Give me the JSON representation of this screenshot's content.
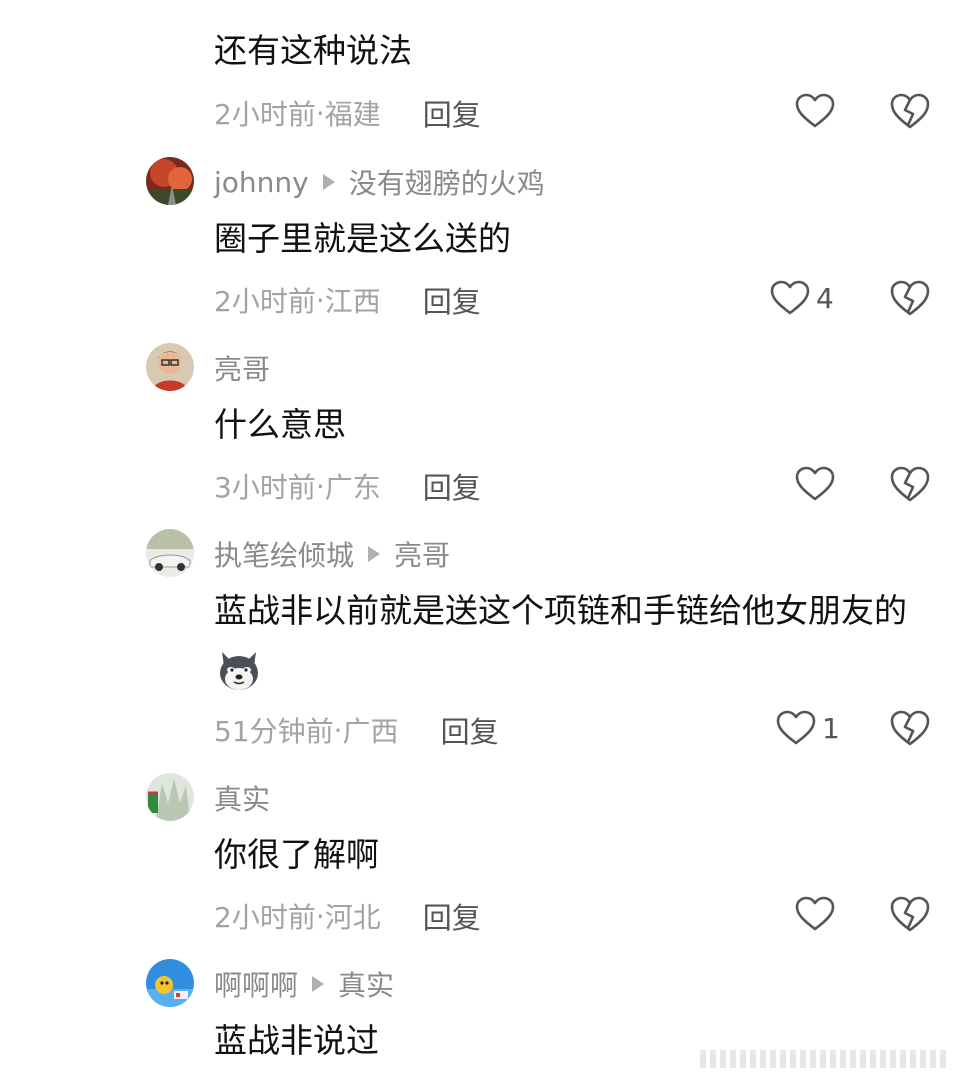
{
  "comments": [
    {
      "user": "",
      "reply_to": "",
      "text": "还有这种说法",
      "time": "2小时前",
      "location": "福建",
      "reply_label": "回复",
      "likes": ""
    },
    {
      "user": "johnny",
      "reply_to": "没有翅膀的火鸡",
      "text": "圈子里就是这么送的",
      "time": "2小时前",
      "location": "江西",
      "reply_label": "回复",
      "likes": "4"
    },
    {
      "user": "亮哥",
      "reply_to": "",
      "text": "什么意思",
      "time": "3小时前",
      "location": "广东",
      "reply_label": "回复",
      "likes": ""
    },
    {
      "user": "执笔绘倾城",
      "reply_to": "亮哥",
      "text": "蓝战非以前就是送这个项链和手链给他女朋友的",
      "time": "51分钟前",
      "location": "广西",
      "reply_label": "回复",
      "likes": "1"
    },
    {
      "user": "真实",
      "reply_to": "",
      "text": "你很了解啊",
      "time": "2小时前",
      "location": "河北",
      "reply_label": "回复",
      "likes": ""
    },
    {
      "user": "啊啊啊",
      "reply_to": "真实",
      "text": "蓝战非说过",
      "time": "",
      "location": "",
      "reply_label": "",
      "likes": ""
    }
  ],
  "separator": " · ",
  "icons": {
    "like": "heart-outline-icon",
    "dislike": "broken-heart-icon",
    "reply_arrow": "triangle-right-icon",
    "emoji": "husky-dog-emoji"
  },
  "colors": {
    "meta": "#8a8a8a",
    "text": "#111111",
    "info": "#a3a3a3",
    "icon": "#555555"
  }
}
